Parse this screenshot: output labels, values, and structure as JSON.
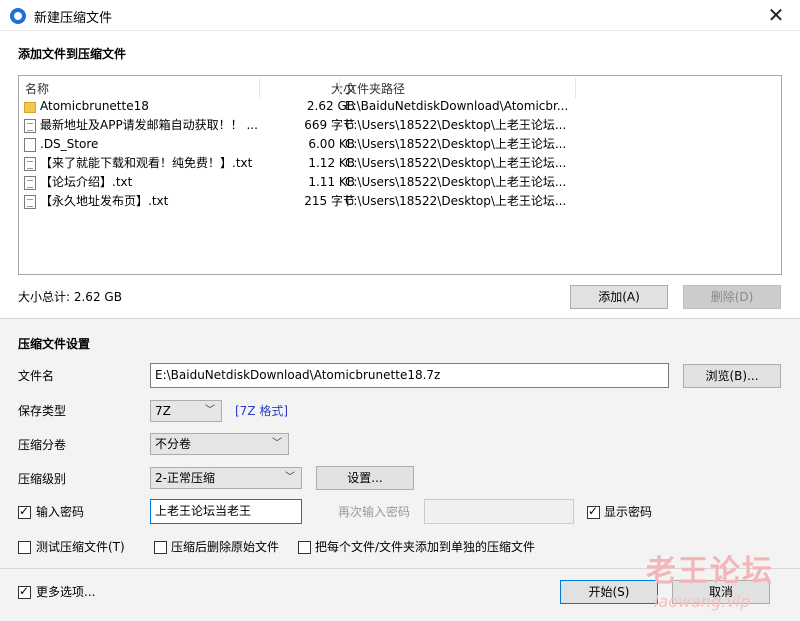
{
  "window": {
    "title": "新建压缩文件",
    "close_glyph": "✕"
  },
  "add_section": {
    "title": "添加文件到压缩文件"
  },
  "file_list": {
    "headers": {
      "name": "名称",
      "size": "大小",
      "path": "文件夹路径"
    },
    "rows": [
      {
        "name": "Atomicbrunette18",
        "size": "2.62 GB",
        "path": "E:\\BaiduNetdiskDownload\\Atomicbr...",
        "type": "folder"
      },
      {
        "name": "最新地址及APP请发邮箱自动获取！！ ...",
        "size": "669 字节",
        "path": "C:\\Users\\18522\\Desktop\\上老王论坛...",
        "type": "txt"
      },
      {
        "name": ".DS_Store",
        "size": "6.00 KB",
        "path": "C:\\Users\\18522\\Desktop\\上老王论坛...",
        "type": "file"
      },
      {
        "name": "【来了就能下载和观看！纯免费！】.txt",
        "size": "1.12 KB",
        "path": "C:\\Users\\18522\\Desktop\\上老王论坛...",
        "type": "txt"
      },
      {
        "name": "【论坛介绍】.txt",
        "size": "1.11 KB",
        "path": "C:\\Users\\18522\\Desktop\\上老王论坛...",
        "type": "txt"
      },
      {
        "name": "【永久地址发布页】.txt",
        "size": "215 字节",
        "path": "C:\\Users\\18522\\Desktop\\上老王论坛...",
        "type": "txt"
      }
    ]
  },
  "total_size": "大小总计: 2.62 GB",
  "buttons": {
    "add": "添加(A)",
    "remove": "删除(D)",
    "browse": "浏览(B)...",
    "settings": "设置...",
    "start": "开始(S)",
    "cancel": "取消"
  },
  "settings_section": {
    "title": "压缩文件设置",
    "filename_label": "文件名",
    "filename_value": "E:\\BaiduNetdiskDownload\\Atomicbrunette18.7z",
    "type_label": "保存类型",
    "type_value": "7Z",
    "type_link": "[7Z 格式]",
    "split_label": "压缩分卷",
    "split_value": "不分卷",
    "level_label": "压缩级别",
    "level_value": "2-正常压缩",
    "password_label": "输入密码",
    "password_checked": true,
    "password_value": "上老王论坛当老王",
    "repeat_password_label": "再次输入密码",
    "repeat_password_value": "",
    "show_password_label": "显示密码",
    "show_password_checked": true,
    "test_label": "测试压缩文件(T)",
    "test_checked": false,
    "delete_label": "压缩后删除原始文件",
    "delete_checked": false,
    "each_label": "把每个文件/文件夹添加到单独的压缩文件",
    "each_checked": false,
    "more_label": "更多选项...",
    "more_checked": true
  },
  "watermark": {
    "line1": "老王论坛",
    "line2": "laowang.vip"
  }
}
